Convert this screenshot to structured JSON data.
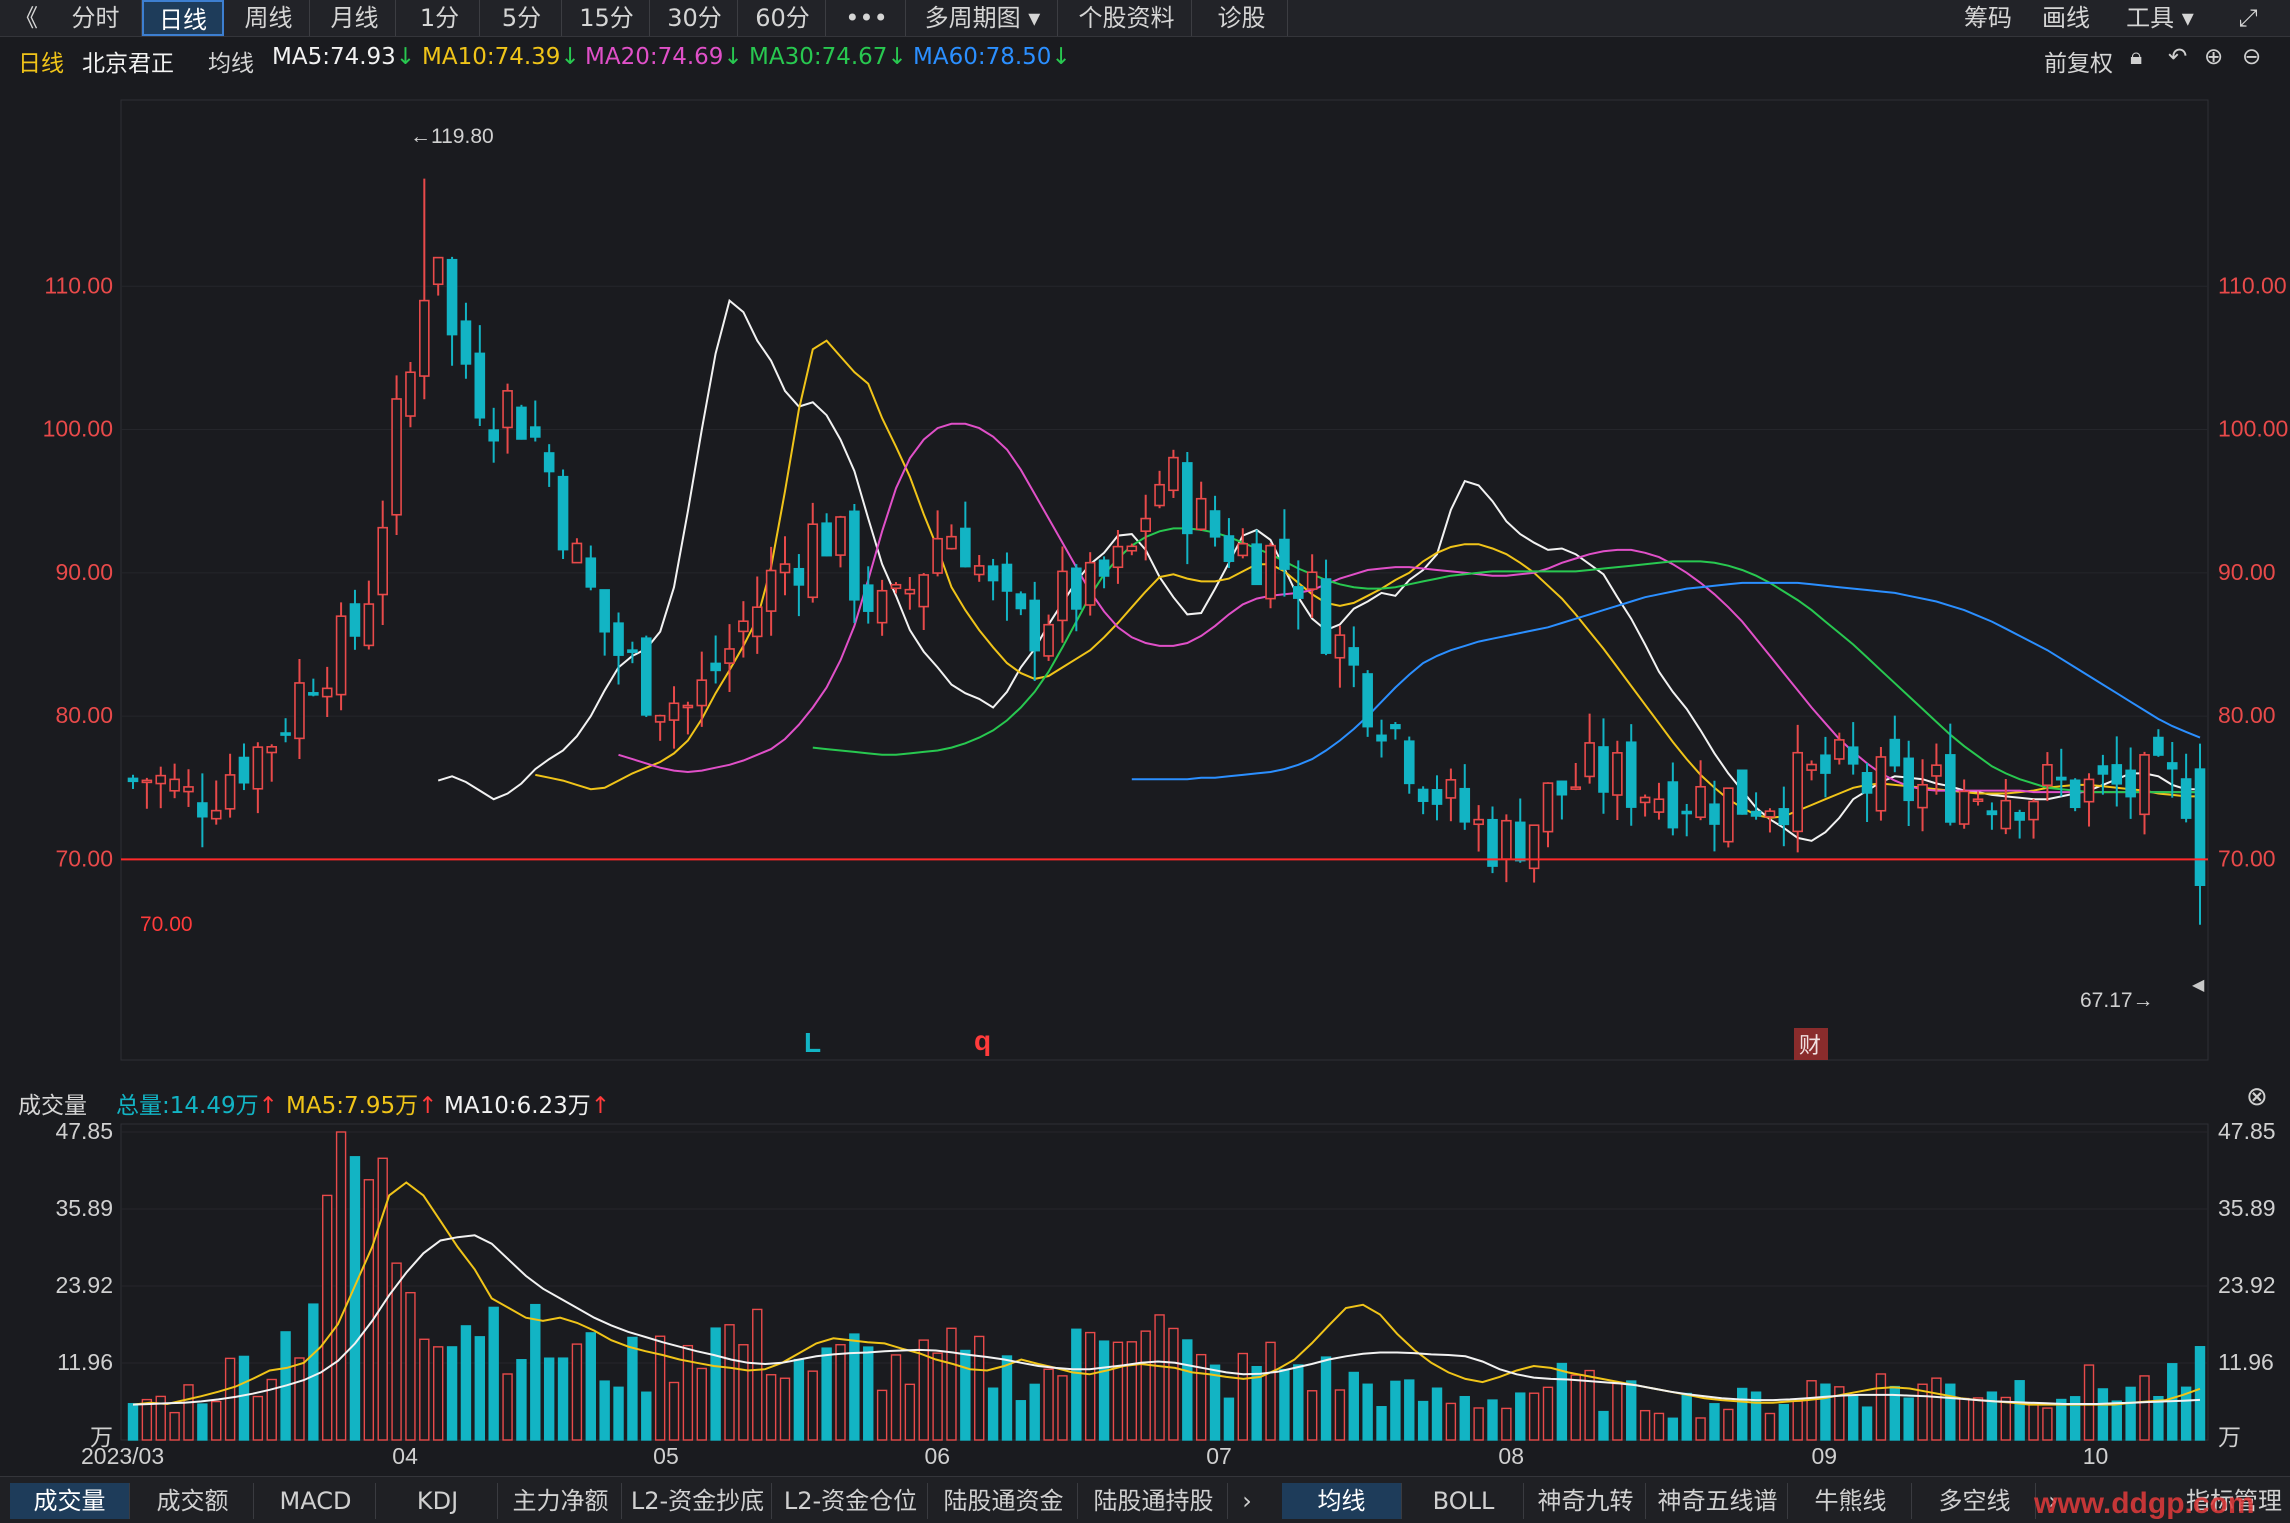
{
  "toolbar": {
    "back": "《",
    "tabs": [
      "分时",
      "日线",
      "周线",
      "月线",
      "1分",
      "5分",
      "15分",
      "30分",
      "60分"
    ],
    "more": "•••",
    "multi": "多周期图",
    "profile": "个股资料",
    "diag": "诊股",
    "right": [
      "筹码",
      "画线",
      "工具"
    ]
  },
  "info": {
    "period": "日线",
    "name": "北京君正",
    "ma_label": "均线",
    "ma5": "MA5:74.93",
    "ma10": "MA10:74.39",
    "ma20": "MA20:74.69",
    "ma30": "MA30:74.67",
    "ma60": "MA60:78.50",
    "fq": "前复权"
  },
  "volume_header": {
    "title": "成交量",
    "total": "总量:14.49万",
    "ma5": "MA5:7.95万",
    "ma10": "MA10:6.23万"
  },
  "bottom_tabs_left": [
    "成交量",
    "成交额",
    "MACD",
    "KDJ",
    "主力净额",
    "L2-资金抄底",
    "L2-资金仓位",
    "陆股通资金",
    "陆股通持股"
  ],
  "bottom_tabs_right": [
    "均线",
    "BOLL",
    "神奇九转",
    "神奇五线谱",
    "牛熊线",
    "多空线"
  ],
  "bottom_more": "指标管理",
  "watermark": "www.ddgp.com",
  "colors": {
    "up": "#e84a4a",
    "down": "#12b4c4",
    "ma5": "#f2f2f2",
    "ma10": "#f0c419",
    "ma20": "#e050c8",
    "ma30": "#28c850",
    "ma60": "#2b8fff",
    "limit": "#ff2a2a"
  },
  "chart_data": [
    {
      "type": "candlestick",
      "title": "北京君正 日线",
      "xlabel": "",
      "ylabel": "",
      "ylim": [
        56.0,
        123.0
      ],
      "yticks": [
        "110.00",
        "100.00",
        "90.00",
        "80.00",
        "70.00"
      ],
      "xticks": [
        "2023/03",
        "04",
        "05",
        "06",
        "07",
        "08",
        "09",
        "10"
      ],
      "annotations": {
        "high": "←119.80",
        "low": "67.17→",
        "line": "70.00",
        "line_value": 70.0,
        "markers": [
          "L",
          "q",
          "财"
        ]
      },
      "ohlc_days": 150,
      "series": [
        {
          "name": "MA5",
          "values": [
            75.5,
            75.8,
            75.4,
            74.8,
            74.2,
            74.6,
            75.3,
            76.3,
            77.0,
            77.6,
            78.6,
            80.0,
            81.8,
            83.4,
            84.2,
            84.7,
            85.9,
            89.0,
            94.3,
            100.0,
            105.3,
            109.0,
            108.2,
            106.2,
            104.8,
            102.7,
            101.6,
            101.9,
            101.0,
            99.3,
            97.1,
            93.8,
            90.6,
            88.4,
            86.0,
            84.5,
            83.4,
            82.2,
            81.6,
            81.2,
            80.6,
            81.7,
            83.4,
            84.7,
            86.4,
            87.9,
            89.4,
            90.6,
            91.4,
            92.6,
            92.7,
            91.6,
            89.7,
            88.3,
            87.1,
            87.2,
            88.9,
            90.7,
            92.6,
            93.0,
            92.3,
            90.3,
            88.3,
            86.8,
            86.0,
            86.4,
            87.5,
            88.0,
            88.6,
            88.4,
            89.5,
            90.2,
            91.3,
            94.4,
            96.4,
            96.1,
            95.0,
            93.6,
            92.7,
            92.1,
            91.6,
            91.7,
            91.3,
            90.6,
            89.9,
            88.3,
            86.8,
            85.0,
            83.1,
            81.7,
            80.5,
            79.0,
            77.4,
            76.0,
            74.8,
            73.6,
            72.8,
            72.2,
            71.5,
            71.3,
            71.9,
            72.9,
            74.2,
            74.8,
            75.4,
            75.8,
            75.7,
            75.6,
            75.3,
            75.1,
            74.8,
            74.7,
            74.5,
            74.4,
            74.3,
            74.2,
            74.2,
            74.4,
            74.6,
            74.8,
            75.2,
            75.6,
            76.0,
            76.0,
            75.8,
            75.2,
            74.9,
            74.9
          ]
        },
        {
          "name": "MA10",
          "values": [
            75.9,
            75.7,
            75.5,
            75.2,
            74.9,
            75.0,
            75.5,
            76.0,
            76.4,
            76.8,
            77.4,
            78.3,
            79.8,
            81.6,
            83.2,
            84.9,
            86.8,
            90.4,
            95.7,
            101.4,
            105.6,
            106.2,
            105.1,
            104.0,
            103.2,
            100.8,
            98.8,
            96.7,
            94.1,
            91.7,
            89.0,
            87.4,
            86.0,
            84.8,
            83.7,
            83.0,
            82.6,
            82.8,
            83.4,
            84.0,
            84.6,
            85.5,
            86.5,
            87.6,
            88.7,
            89.7,
            89.9,
            89.6,
            89.4,
            89.4,
            89.6,
            90.1,
            90.6,
            90.6,
            90.1,
            89.3,
            88.5,
            87.9,
            87.7,
            87.9,
            88.4,
            88.9,
            89.5,
            90.0,
            90.8,
            91.4,
            91.8,
            92.0,
            92.0,
            91.7,
            91.3,
            90.7,
            90.0,
            89.1,
            88.2,
            87.1,
            85.9,
            84.7,
            83.4,
            82.1,
            80.8,
            79.5,
            78.2,
            77.0,
            75.9,
            75.0,
            74.2,
            73.6,
            73.1,
            72.9,
            73.0,
            73.4,
            73.8,
            74.2,
            74.6,
            75.0,
            75.2,
            75.3,
            75.2,
            75.1,
            75.0,
            74.9,
            74.8,
            74.7,
            74.6,
            74.6,
            74.6,
            74.7,
            74.8,
            75.0,
            75.1,
            75.2,
            75.2,
            75.1,
            75.0,
            74.9,
            74.8,
            74.6,
            74.5,
            74.4,
            74.4
          ]
        },
        {
          "name": "MA20",
          "values": [
            77.3,
            77.0,
            76.7,
            76.4,
            76.2,
            76.1,
            76.2,
            76.4,
            76.6,
            76.9,
            77.3,
            77.7,
            78.4,
            79.4,
            80.6,
            82.0,
            83.9,
            86.3,
            89.5,
            92.9,
            95.9,
            98.0,
            99.3,
            100.1,
            100.4,
            100.4,
            100.1,
            99.5,
            98.6,
            97.2,
            95.5,
            93.8,
            92.1,
            90.4,
            88.7,
            87.3,
            86.2,
            85.5,
            85.1,
            84.9,
            84.9,
            85.1,
            85.6,
            86.3,
            87.1,
            87.8,
            88.2,
            88.4,
            88.5,
            88.6,
            88.8,
            89.2,
            89.6,
            89.9,
            90.2,
            90.3,
            90.4,
            90.4,
            90.3,
            90.2,
            90.1,
            90.0,
            89.9,
            89.8,
            89.8,
            89.9,
            90.0,
            90.3,
            90.7,
            91.0,
            91.3,
            91.5,
            91.6,
            91.6,
            91.4,
            91.1,
            90.6,
            90.0,
            89.3,
            88.5,
            87.6,
            86.6,
            85.4,
            84.2,
            83.0,
            81.8,
            80.6,
            79.5,
            78.4,
            77.5,
            76.7,
            76.0,
            75.5,
            75.1,
            74.9,
            74.8,
            74.8,
            74.8,
            74.8,
            74.8,
            74.8,
            74.8,
            74.7,
            74.7,
            74.7,
            74.7,
            74.7,
            74.7,
            74.7,
            74.7,
            74.7,
            74.7,
            74.7,
            74.7,
            74.7
          ]
        },
        {
          "name": "MA30",
          "values": [
            77.8,
            77.7,
            77.6,
            77.5,
            77.4,
            77.3,
            77.3,
            77.4,
            77.5,
            77.6,
            77.8,
            78.1,
            78.5,
            79.0,
            79.7,
            80.6,
            81.7,
            83.1,
            84.8,
            86.6,
            88.4,
            89.9,
            91.0,
            91.9,
            92.5,
            92.9,
            93.1,
            93.1,
            93.0,
            92.8,
            92.5,
            92.1,
            91.7,
            91.3,
            90.8,
            90.3,
            89.9,
            89.5,
            89.2,
            89.0,
            88.9,
            88.9,
            89.0,
            89.2,
            89.4,
            89.6,
            89.8,
            89.9,
            90.0,
            90.1,
            90.1,
            90.1,
            90.1,
            90.1,
            90.1,
            90.1,
            90.2,
            90.3,
            90.4,
            90.5,
            90.6,
            90.7,
            90.8,
            90.8,
            90.8,
            90.7,
            90.5,
            90.2,
            89.8,
            89.3,
            88.7,
            88.1,
            87.4,
            86.6,
            85.8,
            85.0,
            84.1,
            83.2,
            82.3,
            81.4,
            80.5,
            79.6,
            78.7,
            77.9,
            77.2,
            76.5,
            76.0,
            75.6,
            75.3,
            75.0,
            74.9,
            74.8,
            74.7,
            74.7,
            74.7,
            74.7,
            74.7,
            74.7,
            74.7,
            74.7,
            74.7
          ]
        },
        {
          "name": "MA60",
          "values": [
            75.6,
            75.6,
            75.6,
            75.6,
            75.6,
            75.7,
            75.7,
            75.8,
            75.9,
            76.0,
            76.1,
            76.3,
            76.6,
            77.0,
            77.6,
            78.3,
            79.1,
            80.0,
            81.0,
            82.0,
            82.9,
            83.7,
            84.2,
            84.6,
            84.9,
            85.2,
            85.4,
            85.6,
            85.8,
            86.0,
            86.2,
            86.5,
            86.8,
            87.1,
            87.4,
            87.7,
            88.0,
            88.3,
            88.5,
            88.7,
            88.9,
            89.0,
            89.1,
            89.2,
            89.3,
            89.3,
            89.3,
            89.3,
            89.3,
            89.2,
            89.1,
            89.0,
            88.9,
            88.8,
            88.7,
            88.6,
            88.4,
            88.2,
            88.0,
            87.7,
            87.4,
            87.0,
            86.6,
            86.1,
            85.6,
            85.1,
            84.6,
            84.0,
            83.4,
            82.8,
            82.2,
            81.6,
            81.0,
            80.4,
            79.8,
            79.3,
            78.9,
            78.5
          ]
        }
      ]
    },
    {
      "type": "bar",
      "title": "成交量",
      "ylim": [
        0,
        47.85
      ],
      "yticks": [
        "47.85",
        "35.89",
        "23.92",
        "11.96",
        "万"
      ],
      "bar_count": 150,
      "series": [
        {
          "name": "MA5",
          "values": [
            5.5,
            5.8,
            5.6,
            6.2,
            6.8,
            7.5,
            8.3,
            9.5,
            10.8,
            11.2,
            12.0,
            14.5,
            18.0,
            24.0,
            30.0,
            38.0,
            40.0,
            38.0,
            34.0,
            30.0,
            26.5,
            22.0,
            20.5,
            19.0,
            18.5,
            19.0,
            18.2,
            17.0,
            15.5,
            14.5,
            13.8,
            13.2,
            12.5,
            12.0,
            11.5,
            11.2,
            10.8,
            11.0,
            12.0,
            13.5,
            15.0,
            15.8,
            15.5,
            15.2,
            15.0,
            14.2,
            13.5,
            12.5,
            11.8,
            11.0,
            10.8,
            11.5,
            12.5,
            11.8,
            11.2,
            10.5,
            10.2,
            10.8,
            11.5,
            11.8,
            11.5,
            11.2,
            10.5,
            10.2,
            9.8,
            9.5,
            9.8,
            11.0,
            12.5,
            15.0,
            17.8,
            20.5,
            21.0,
            19.5,
            16.5,
            14.0,
            12.0,
            10.5,
            9.5,
            9.0,
            9.8,
            10.8,
            11.5,
            11.2,
            10.5,
            10.0,
            9.5,
            9.0,
            8.5,
            8.0,
            7.5,
            7.0,
            6.5,
            6.2,
            6.0,
            5.8,
            5.8,
            6.0,
            6.2,
            6.5,
            7.0,
            7.5,
            8.0,
            8.2,
            8.0,
            7.5,
            7.0,
            6.5,
            6.2,
            6.0,
            5.8,
            5.5,
            5.5,
            5.5,
            5.5,
            5.5,
            5.5,
            5.8,
            6.0,
            6.2,
            7.0,
            7.95
          ]
        },
        {
          "name": "MA10",
          "values": [
            5.5,
            5.6,
            5.7,
            5.8,
            6.0,
            6.3,
            6.7,
            7.2,
            7.8,
            8.5,
            9.3,
            10.5,
            12.3,
            15.0,
            18.5,
            22.5,
            26.0,
            29.0,
            31.0,
            31.5,
            31.8,
            30.5,
            28.0,
            25.5,
            23.5,
            22.0,
            20.5,
            19.0,
            17.8,
            16.8,
            16.0,
            15.2,
            14.5,
            13.8,
            13.2,
            12.5,
            12.0,
            11.8,
            12.0,
            12.5,
            13.0,
            13.3,
            13.5,
            13.6,
            13.8,
            13.9,
            14.0,
            13.9,
            13.6,
            13.2,
            12.9,
            12.5,
            12.0,
            11.5,
            11.2,
            11.0,
            11.0,
            11.3,
            11.6,
            12.0,
            12.2,
            12.0,
            11.5,
            11.0,
            10.5,
            10.2,
            10.3,
            10.6,
            11.2,
            11.8,
            12.5,
            13.0,
            13.4,
            13.6,
            13.6,
            13.5,
            13.3,
            13.2,
            13.0,
            12.2,
            11.0,
            10.2,
            9.7,
            9.5,
            9.4,
            9.2,
            9.0,
            8.8,
            8.5,
            8.0,
            7.5,
            7.1,
            6.8,
            6.5,
            6.3,
            6.2,
            6.2,
            6.3,
            6.5,
            6.7,
            6.9,
            7.0,
            7.0,
            7.0,
            6.9,
            6.8,
            6.6,
            6.4,
            6.2,
            6.0,
            5.9,
            5.8,
            5.7,
            5.6,
            5.6,
            5.6,
            5.7,
            5.8,
            5.9,
            6.0,
            6.1,
            6.23
          ]
        }
      ]
    }
  ]
}
